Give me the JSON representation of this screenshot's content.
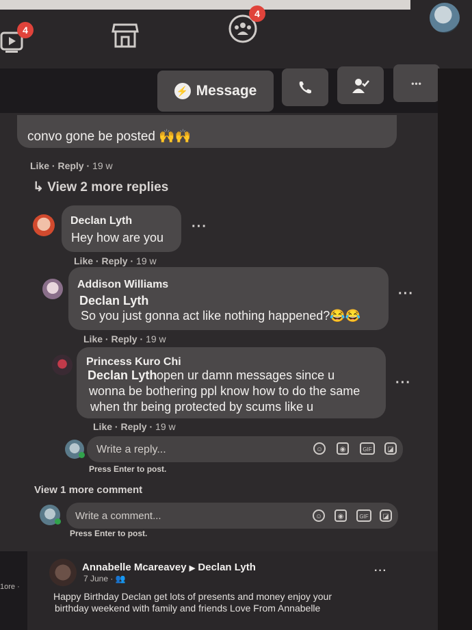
{
  "nav": {
    "watch_badge": "4",
    "groups_badge": "4"
  },
  "profile_actions": {
    "message_label": "Message",
    "more_label": "•••"
  },
  "comments": {
    "top_fragment_text": "convo gone be posted 🙌🙌",
    "top_like": "Like",
    "top_reply": "Reply",
    "top_time": "19 w",
    "view_more_replies": "View 2 more replies",
    "replies": [
      {
        "author": "Declan Lyth",
        "mention": "",
        "text": "Hey how are you",
        "like": "Like",
        "reply": "Reply",
        "time": "19 w"
      },
      {
        "author": "Addison Williams",
        "mention": "Declan Lyth",
        "text": "So you just gonna act like nothing happened?😂😂",
        "like": "Like",
        "reply": "Reply",
        "time": "19 w"
      },
      {
        "author": "Princess Kuro Chi",
        "mention": "Declan Lyth",
        "text_lines": [
          "open ur damn messages since u",
          "wonna be bothering ppl know how to do the same",
          "when thr being protected by scums like u"
        ],
        "like": "Like",
        "reply": "Reply",
        "time": "19 w"
      }
    ],
    "reply_placeholder": "Write a reply...",
    "reply_hint": "Press Enter to post.",
    "view_more_comment": "View 1 more comment",
    "comment_placeholder": "Write a comment...",
    "comment_hint": "Press Enter to post."
  },
  "post": {
    "author": "Annabelle Mcareavey",
    "target": "Declan Lyth",
    "date": "7 June",
    "text_line1": "Happy Birthday Declan get lots of presents and money enjoy your",
    "text_line2": "birthday weekend with family and friends Love From Annabelle",
    "side_label": "1ore ·"
  },
  "colors": {
    "background": "#1c1a1d",
    "bubble": "#4b4849",
    "badge": "#e0433b"
  }
}
